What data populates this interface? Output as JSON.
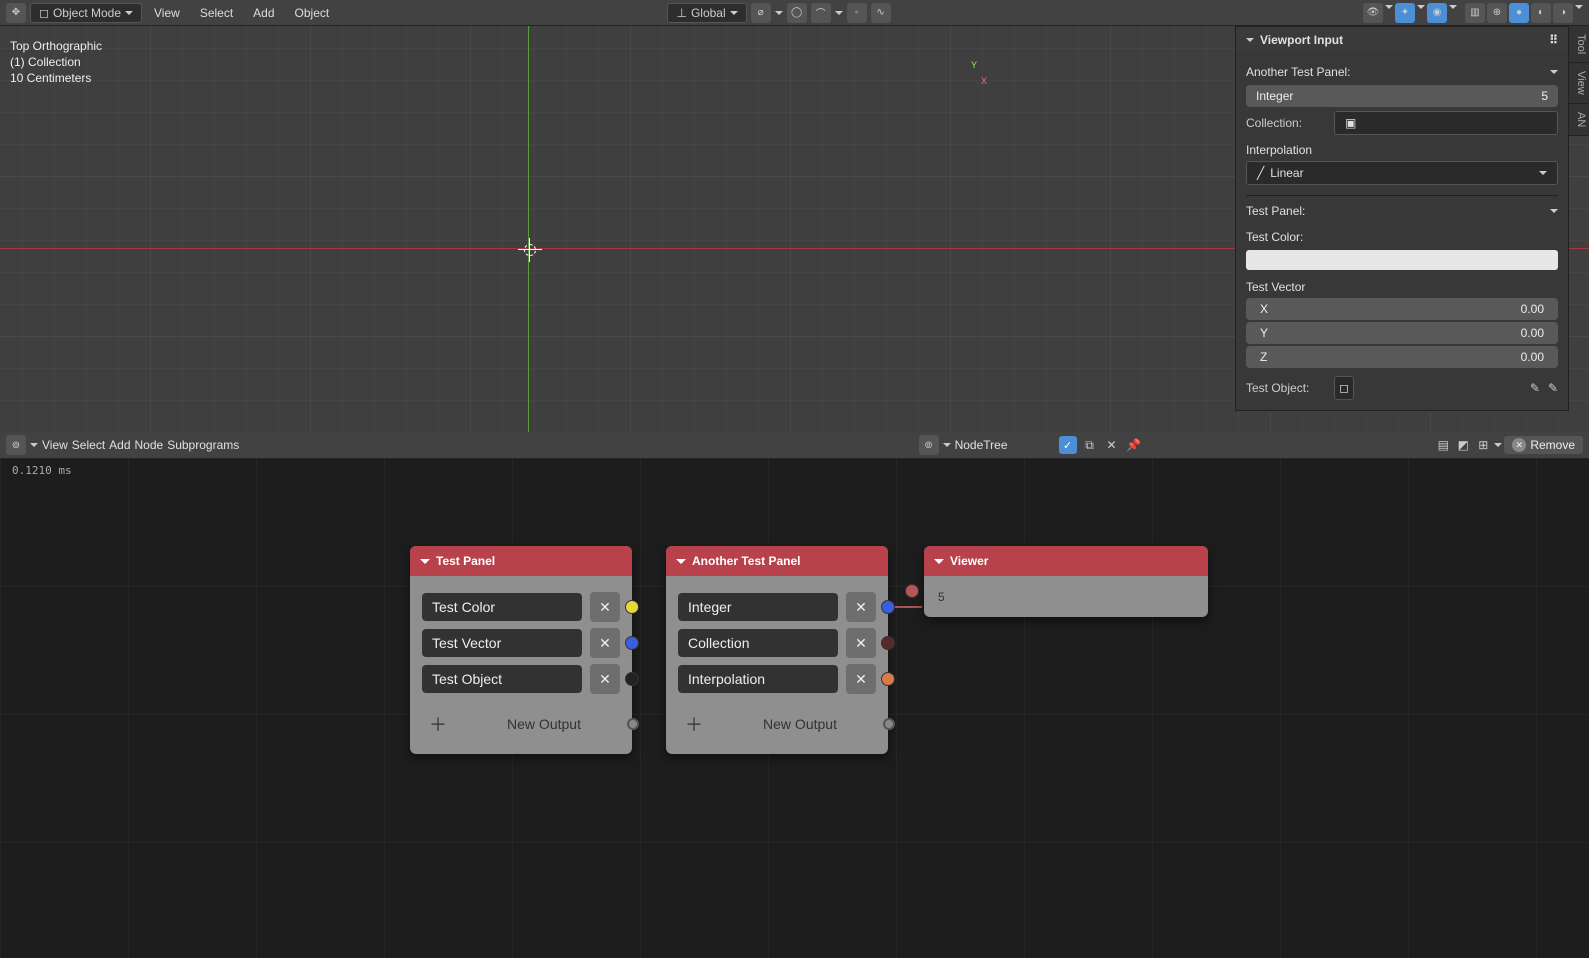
{
  "top": {
    "mode_label": "Object Mode",
    "menu": [
      "View",
      "Select",
      "Add",
      "Object"
    ],
    "orientation": "Global"
  },
  "viewport": {
    "info": [
      "Top Orthographic",
      "(1) Collection",
      "10 Centimeters"
    ]
  },
  "side": {
    "title": "Viewport Input",
    "panel_a": {
      "title": "Another Test Panel:",
      "int_label": "Integer",
      "int_value": "5",
      "collection_label": "Collection:",
      "interp_label": "Interpolation",
      "interp_value": "Linear"
    },
    "panel_b": {
      "title": "Test Panel:",
      "color_label": "Test Color:",
      "vector_label": "Test Vector",
      "vx_label": "X",
      "vx": "0.00",
      "vy_label": "Y",
      "vy": "0.00",
      "vz_label": "Z",
      "vz": "0.00",
      "object_label": "Test Object:"
    }
  },
  "tabs": [
    "Tool",
    "View",
    "AN"
  ],
  "node_header": {
    "menu": [
      "View",
      "Select",
      "Add",
      "Node",
      "Subprograms"
    ],
    "tree_name": "NodeTree",
    "remove": "Remove"
  },
  "perf": "0.1210 ms",
  "nodes": {
    "test_panel": {
      "title": "Test Panel",
      "rows": [
        {
          "label": "Test Color",
          "color": "#e7d83a"
        },
        {
          "label": "Test Vector",
          "color": "#3b5ee0"
        },
        {
          "label": "Test Object",
          "color": "#222"
        }
      ],
      "new_output": "New Output"
    },
    "another": {
      "title": "Another Test Panel",
      "rows": [
        {
          "label": "Integer",
          "color": "#3b5ee0"
        },
        {
          "label": "Collection",
          "color": "#5a2828"
        },
        {
          "label": "Interpolation",
          "color": "#d87a4a"
        }
      ],
      "new_output": "New Output"
    },
    "viewer": {
      "title": "Viewer",
      "value": "5"
    }
  }
}
